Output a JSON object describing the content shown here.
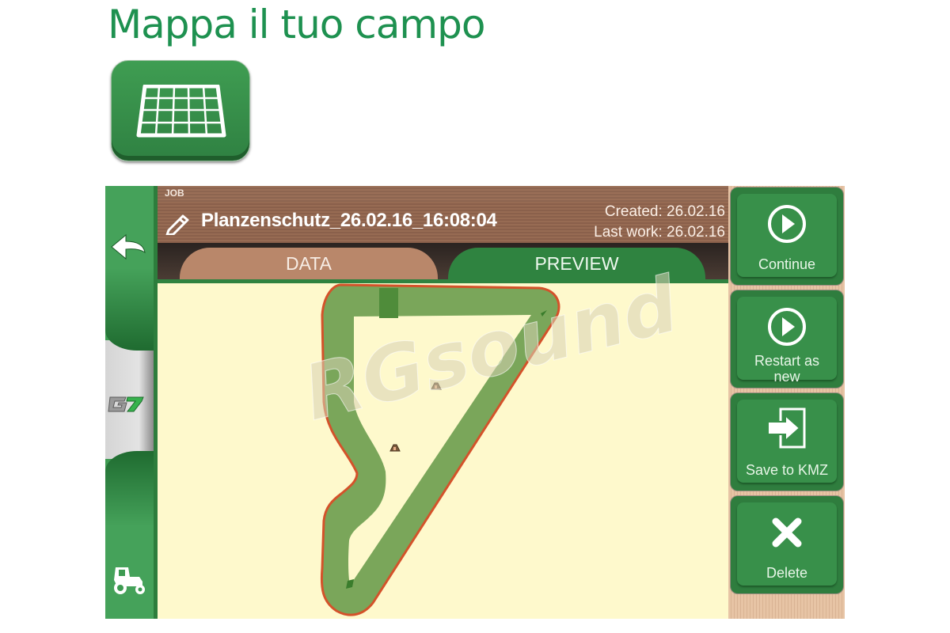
{
  "page": {
    "title": "Mappa il tuo campo",
    "app_icon": "field-grid-icon"
  },
  "sidebar": {
    "back_icon": "back-arrow-icon",
    "logo_text": "G7",
    "bottom_icon": "tractor-icon"
  },
  "header": {
    "section_label": "JOB",
    "edit_icon": "pencil-icon",
    "job_name": "Planzenschutz_26.02.16_16:08:04",
    "created": "Created: 26.02.16",
    "last_work": "Last work: 26.02.16"
  },
  "tabs": [
    {
      "label": "DATA",
      "active": false
    },
    {
      "label": "PREVIEW",
      "active": true
    }
  ],
  "map": {
    "markers": [
      {
        "name": "obstacle-marker-1",
        "icon": "cone-icon"
      },
      {
        "name": "obstacle-marker-2",
        "icon": "cone-icon"
      }
    ],
    "colors": {
      "background": "#fef9cc",
      "worked_area": "#7aa65a",
      "boundary": "#d4522a",
      "start_marker": "#3a7d2c"
    }
  },
  "actions": [
    {
      "label": "Continue",
      "icon": "play-circle-icon"
    },
    {
      "label": "Restart as\nnew",
      "label_line1": "Restart as",
      "label_line2": "new",
      "icon": "play-circle-icon"
    },
    {
      "label": "Save to KMZ",
      "icon": "export-icon"
    },
    {
      "label": "Delete",
      "icon": "delete-x-icon"
    }
  ],
  "watermark": "RGsound",
  "colors": {
    "title_green": "#1e9150",
    "button_green": "#38904a",
    "header_brown": "#976b53",
    "tab_data": "#b9876a",
    "tab_preview": "#2f8340"
  }
}
